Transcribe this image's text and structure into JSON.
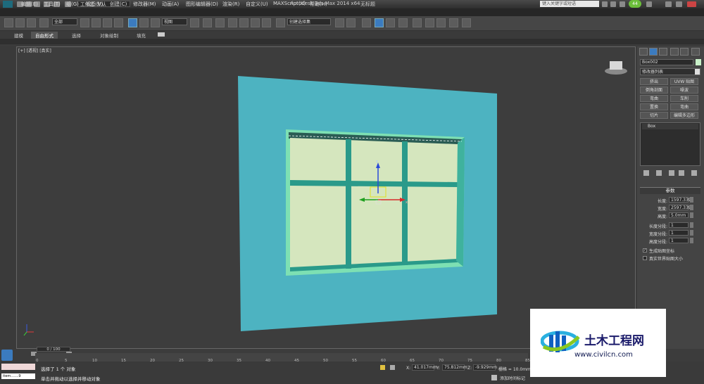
{
  "titlebar": {
    "workspace": "工作区: 默认",
    "title": "Autodesk 3ds Max  2014 x64",
    "file": "无标题",
    "search_placeholder": "键入关键字或短语",
    "badge": "44"
  },
  "menu": [
    "编辑(E)",
    "工具(T)",
    "组(G)",
    "视图(V)",
    "创建(C)",
    "修改器(M)",
    "动画(A)",
    "图形编辑器(D)",
    "渲染(R)",
    "自定义(U)",
    "MAXScript(X)",
    "帮助(H)"
  ],
  "toolbar": {
    "selection_filter": "全部",
    "ref_coord": "视图",
    "named_selection": "创建选择集"
  },
  "ribbon_tabs": [
    "建模",
    "自由形式",
    "选择",
    "对象绘制",
    "填充"
  ],
  "viewport": {
    "label": "[+] [透视] [真实]"
  },
  "command_panel": {
    "object_name": "Box002",
    "modifier_list": "修改器列表",
    "modifier_buttons": [
      "挤出",
      "UVW 贴图",
      "倒角剖面",
      "噪波",
      "弯曲",
      "车削",
      "置换",
      "弯曲",
      "切片",
      "编辑多边形"
    ],
    "stack_item": "Box",
    "params_title": "参数",
    "params": [
      {
        "label": "长度:",
        "value": "1597.339"
      },
      {
        "label": "宽度:",
        "value": "2597.339"
      },
      {
        "label": "高度:",
        "value": "5.0mm"
      },
      {
        "label": "长度分段:",
        "value": "1"
      },
      {
        "label": "宽度分段:",
        "value": "1"
      },
      {
        "label": "高度分段:",
        "value": "1"
      }
    ],
    "checkbox_1": "生成贴图坐标",
    "checkbox_2": "真实世界贴图大小"
  },
  "timeline": {
    "frame_counter": "0 / 100",
    "ticks": [
      "0",
      "5",
      "10",
      "15",
      "20",
      "25",
      "30",
      "35",
      "40",
      "45",
      "50",
      "55",
      "60",
      "65",
      "70",
      "75",
      "80",
      "85"
    ]
  },
  "status": {
    "selection": "选择了 1 个 对象",
    "hint": "单击并拖动以选择并移动对象",
    "maxscript": "item.......9",
    "x_label": "X:",
    "x_value": "41.017mm",
    "y_label": "Y:",
    "y_value": "75.812mm",
    "z_label": "Z:",
    "z_value": "-9.929mm",
    "grid": "栅格 = 10.0mm",
    "add_time_tag": "添加时间标记"
  },
  "watermark": {
    "title": "土木工程网",
    "url": "www.civilcn.com"
  },
  "colors": {
    "panel_blue": "#4fb6c2",
    "window_frame": "#7ee0b4",
    "glass": "#d4e6c0",
    "mullion": "#2a9a8a"
  }
}
